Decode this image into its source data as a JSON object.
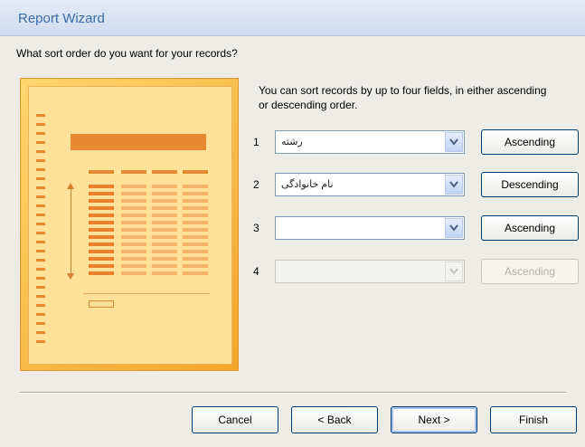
{
  "window": {
    "title": "Report Wizard"
  },
  "question": "What sort order do you want for your records?",
  "instruction": "You can sort records by up to four fields, in either ascending or descending order.",
  "sort_fields": [
    {
      "number": "1",
      "value": "رشته",
      "order": "Ascending",
      "enabled": true
    },
    {
      "number": "2",
      "value": "نام خانوادگی",
      "order": "Descending",
      "enabled": true
    },
    {
      "number": "3",
      "value": "",
      "order": "Ascending",
      "enabled": true
    },
    {
      "number": "4",
      "value": "",
      "order": "Ascending",
      "enabled": false
    }
  ],
  "buttons": {
    "cancel": "Cancel",
    "back": "< Back",
    "next": "Next >",
    "finish": "Finish"
  },
  "colors": {
    "titlebar_text": "#3a6aa8",
    "illustration": "#f2a52a",
    "button_border": "#003c74"
  }
}
